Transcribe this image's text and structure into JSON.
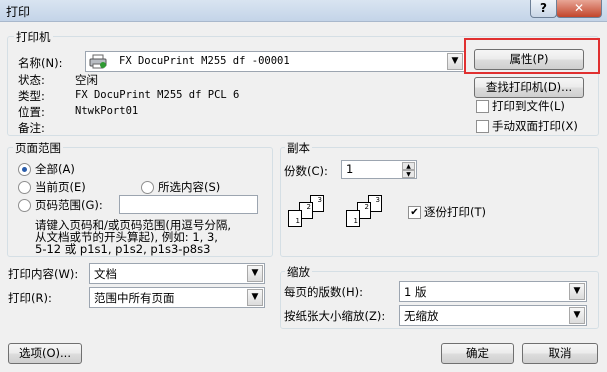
{
  "window": {
    "title": "打印",
    "help": "?",
    "close": "✕"
  },
  "printer": {
    "group_title": "打印机",
    "name_label": "名称(N):",
    "name_value": "FX DocuPrint M255 df -00001",
    "status_label": "状态:",
    "status_value": "空闲",
    "type_label": "类型:",
    "type_value": "FX DocuPrint M255 df PCL 6",
    "where_label": "位置:",
    "where_value": "NtwkPort01",
    "comment_label": "备注:",
    "properties_button": "属性(P)",
    "find_button": "查找打印机(D)...",
    "print_to_file": "打印到文件(L)",
    "manual_duplex": "手动双面打印(X)",
    "print_to_file_checked": false,
    "manual_duplex_checked": false
  },
  "page_range": {
    "group_title": "页面范围",
    "all": "全部(A)",
    "current": "当前页(E)",
    "selection": "所选内容(S)",
    "pages": "页码范围(G):",
    "pages_value": "",
    "hint_line1": "请键入页码和/或页码范围(用逗号分隔,",
    "hint_line2": "从文档或节的开头算起), 例如: 1, 3,",
    "hint_line3": "5-12 或 p1s1, p1s2, p1s3-p8s3",
    "selected": "all"
  },
  "copies": {
    "group_title": "副本",
    "count_label": "份数(C):",
    "count_value": "1",
    "collate": "逐份打印(T)",
    "collate_checked": true,
    "collate_page_labels": [
      "1",
      "2",
      "3"
    ]
  },
  "print_what": {
    "label": "打印内容(W):",
    "value": "文档"
  },
  "print": {
    "label": "打印(R):",
    "value": "范围中所有页面"
  },
  "zoom": {
    "group_title": "缩放",
    "pages_per_sheet_label": "每页的版数(H):",
    "pages_per_sheet_value": "1 版",
    "scale_label": "按纸张大小缩放(Z):",
    "scale_value": "无缩放"
  },
  "footer": {
    "options": "选项(O)...",
    "ok": "确定",
    "cancel": "取消"
  },
  "colors": {
    "highlight": "#e03030"
  }
}
